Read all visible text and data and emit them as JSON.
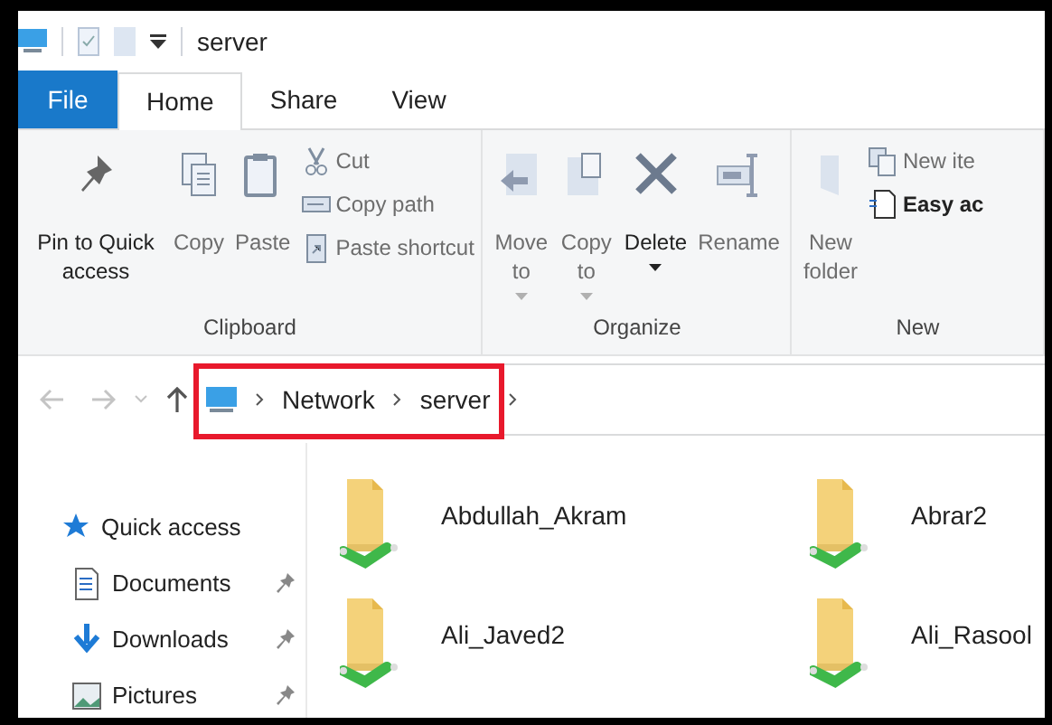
{
  "window": {
    "title": "server"
  },
  "tabs": [
    {
      "label": "File",
      "kind": "file",
      "selected": false
    },
    {
      "label": "Home",
      "kind": "tab",
      "selected": true
    },
    {
      "label": "Share",
      "kind": "tab",
      "selected": false
    },
    {
      "label": "View",
      "kind": "tab",
      "selected": false
    }
  ],
  "ribbon": {
    "groups": [
      {
        "label": "Clipboard",
        "large": [
          {
            "label": "Pin to Quick access",
            "disabled": false
          },
          {
            "label": "Copy",
            "disabled": true
          },
          {
            "label": "Paste",
            "disabled": true
          }
        ],
        "small": [
          {
            "label": "Cut",
            "disabled": true
          },
          {
            "label": "Copy path",
            "disabled": true
          },
          {
            "label": "Paste shortcut",
            "disabled": true
          }
        ]
      },
      {
        "label": "Organize",
        "large": [
          {
            "label": "Move to",
            "disabled": true,
            "dropdown": true
          },
          {
            "label": "Copy to",
            "disabled": true,
            "dropdown": true
          },
          {
            "label": "Delete",
            "disabled": false,
            "dropdown": true
          },
          {
            "label": "Rename",
            "disabled": true
          }
        ]
      },
      {
        "label": "New",
        "large": [
          {
            "label": "New folder",
            "disabled": true
          }
        ],
        "small": [
          {
            "label": "New ite",
            "disabled": true
          },
          {
            "label": "Easy ac",
            "disabled": false
          }
        ]
      }
    ]
  },
  "address": {
    "path": [
      "Network",
      "server"
    ]
  },
  "nav_pane": {
    "items": [
      {
        "label": "Quick access",
        "kind": "quick_access",
        "pinned": false
      },
      {
        "label": "Documents",
        "kind": "documents",
        "pinned": true
      },
      {
        "label": "Downloads",
        "kind": "downloads",
        "pinned": true
      },
      {
        "label": "Pictures",
        "kind": "pictures",
        "pinned": true
      }
    ]
  },
  "folders": [
    {
      "name": "Abdullah_Akram"
    },
    {
      "name": "Abrar2"
    },
    {
      "name": "Ali_Javed2"
    },
    {
      "name": "Ali_Rasool"
    }
  ]
}
